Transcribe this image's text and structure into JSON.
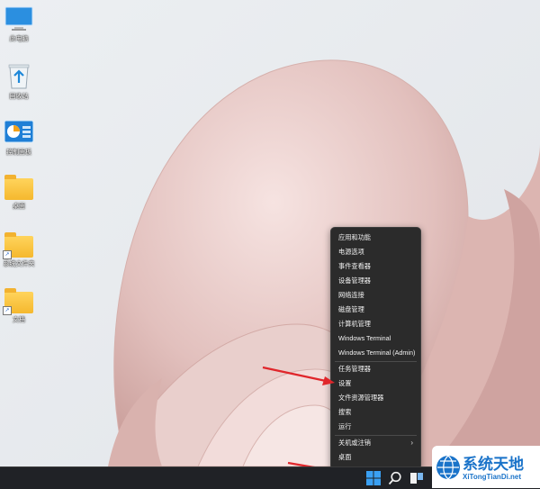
{
  "desktop": {
    "icons": [
      {
        "label": "此电脑",
        "icon": "monitor-icon"
      },
      {
        "label": "回收站",
        "icon": "recycle-bin-icon"
      },
      {
        "label": "控制面板",
        "icon": "control-panel-icon"
      },
      {
        "label": "桌面",
        "icon": "folder-icon"
      },
      {
        "label": "系统文件夹",
        "icon": "folder-shortcut-icon"
      },
      {
        "label": "文档",
        "icon": "folder-shortcut-icon"
      }
    ]
  },
  "context_menu": {
    "items": [
      "应用和功能",
      "电源选项",
      "事件查看器",
      "设备管理器",
      "网络连接",
      "磁盘管理",
      "计算机管理",
      "Windows Terminal",
      "Windows Terminal (Admin)",
      "任务管理器",
      "设置",
      "文件资源管理器",
      "搜索",
      "运行",
      "关机或注销",
      "桌面"
    ]
  },
  "taskbar": {
    "items": [
      "start-icon",
      "search-icon",
      "task-view-icon"
    ]
  },
  "watermark": {
    "title": "系统天地",
    "url": "XiTongTianDi.net"
  },
  "colors": {
    "menu_bg": "#2b2b2b",
    "taskbar_bg": "#202226",
    "arrow": "#e0262b",
    "accent": "#1a73c9"
  }
}
